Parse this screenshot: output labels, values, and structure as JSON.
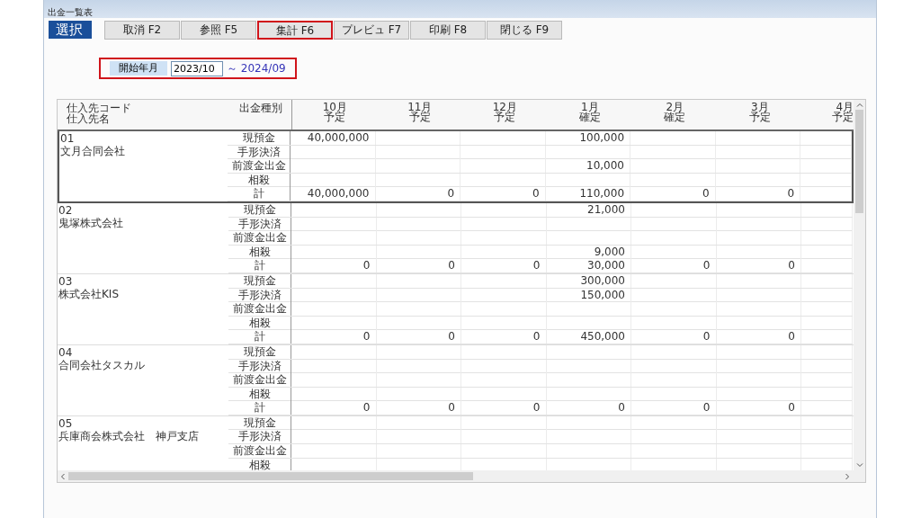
{
  "window": {
    "title": "出金一覧表"
  },
  "toolbar": {
    "select_label": "選択",
    "buttons": [
      {
        "label": "取消 F2",
        "highlighted": false
      },
      {
        "label": "参照 F5",
        "highlighted": false
      },
      {
        "label": "集計 F6",
        "highlighted": true
      },
      {
        "label": "プレビュ F7",
        "highlighted": false
      },
      {
        "label": "印刷 F8",
        "highlighted": false
      },
      {
        "label": "閉じる F9",
        "highlighted": false
      }
    ]
  },
  "filter": {
    "label": "開始年月",
    "value": "2023/10",
    "separator": "～",
    "end": "2024/09",
    "highlighted": true
  },
  "table": {
    "header": {
      "code": "仕入先コード",
      "name": "仕入先名",
      "type": "出金種別"
    },
    "columns": [
      {
        "month": "10月",
        "status": "予定"
      },
      {
        "month": "11月",
        "status": "予定"
      },
      {
        "month": "12月",
        "status": "予定"
      },
      {
        "month": "1月",
        "status": "確定"
      },
      {
        "month": "2月",
        "status": "確定"
      },
      {
        "month": "3月",
        "status": "予定"
      },
      {
        "month": "4月",
        "status": "予定"
      }
    ],
    "suppliers": [
      {
        "code": "01",
        "name": "文月合同会社",
        "selected": true,
        "rows": [
          {
            "type": "現預金",
            "values": {
              "col_1": "40,000,000",
              "col_4": "100,000"
            }
          },
          {
            "type": "手形決済"
          },
          {
            "type": "前渡金出金",
            "values": {
              "col_4": "10,000"
            }
          },
          {
            "type": "相殺"
          },
          {
            "type": "計",
            "values": {
              "col_1": "40,000,000",
              "col_2": "0",
              "col_3": "0",
              "col_4": "110,000",
              "col_5": "0",
              "col_6": "0"
            }
          }
        ]
      },
      {
        "code": "02",
        "name": "鬼塚株式会社",
        "selected": false,
        "rows": [
          {
            "type": "現預金",
            "values": {
              "col_4": "21,000"
            }
          },
          {
            "type": "手形決済"
          },
          {
            "type": "前渡金出金"
          },
          {
            "type": "相殺",
            "values": {
              "col_4": "9,000"
            }
          },
          {
            "type": "計",
            "values": {
              "col_1": "0",
              "col_2": "0",
              "col_3": "0",
              "col_4": "30,000",
              "col_5": "0",
              "col_6": "0"
            }
          }
        ]
      },
      {
        "code": "03",
        "name": "株式会社KIS",
        "selected": false,
        "rows": [
          {
            "type": "現預金",
            "values": {
              "col_4": "300,000"
            }
          },
          {
            "type": "手形決済",
            "values": {
              "col_4": "150,000"
            }
          },
          {
            "type": "前渡金出金"
          },
          {
            "type": "相殺"
          },
          {
            "type": "計",
            "values": {
              "col_1": "0",
              "col_2": "0",
              "col_3": "0",
              "col_4": "450,000",
              "col_5": "0",
              "col_6": "0"
            }
          }
        ]
      },
      {
        "code": "04",
        "name": "合同会社タスカル",
        "selected": false,
        "rows": [
          {
            "type": "現預金"
          },
          {
            "type": "手形決済"
          },
          {
            "type": "前渡金出金"
          },
          {
            "type": "相殺"
          },
          {
            "type": "計",
            "values": {
              "col_1": "0",
              "col_2": "0",
              "col_3": "0",
              "col_4": "0",
              "col_5": "0",
              "col_6": "0"
            }
          }
        ]
      },
      {
        "code": "05",
        "name": "兵庫商会株式会社　神戸支店",
        "selected": false,
        "rows": [
          {
            "type": "現預金"
          },
          {
            "type": "手形決済"
          },
          {
            "type": "前渡金出金"
          },
          {
            "type": "相殺"
          }
        ]
      }
    ]
  }
}
